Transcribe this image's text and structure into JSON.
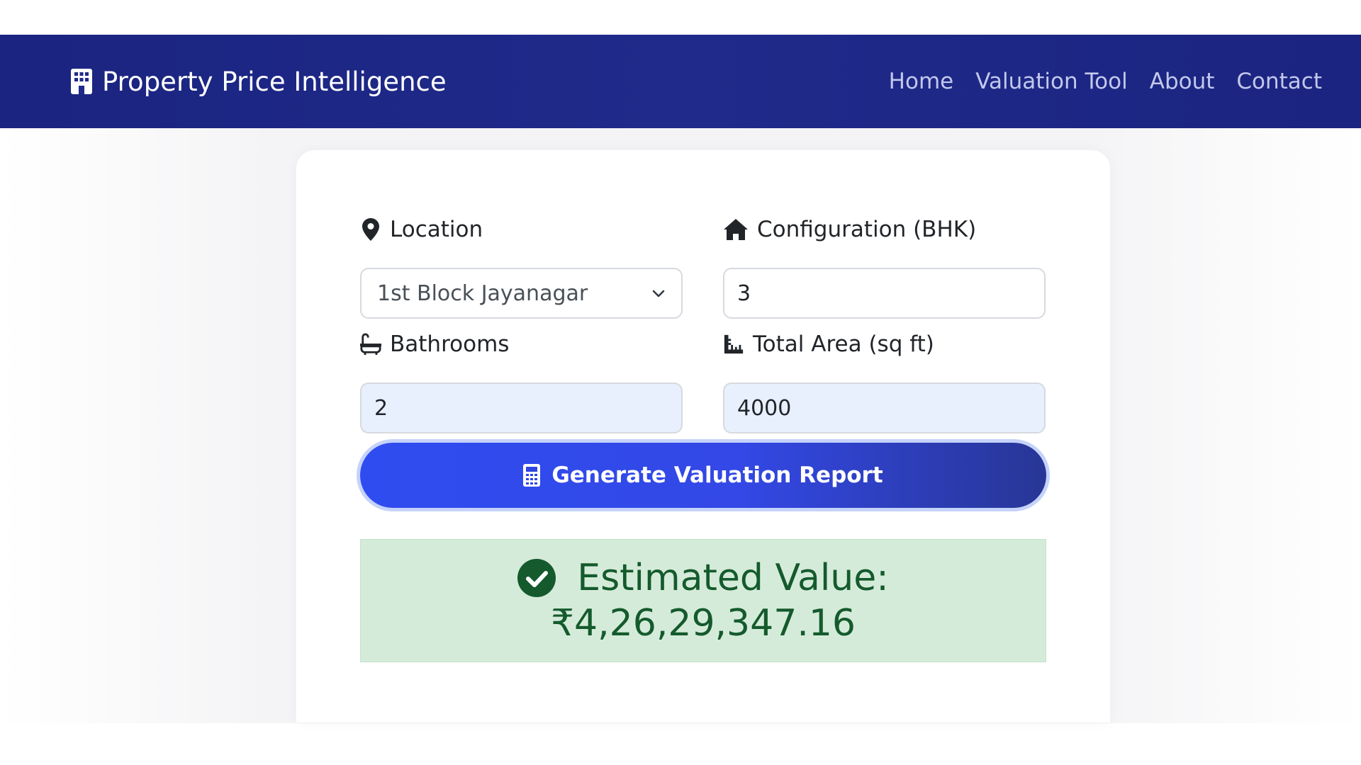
{
  "navbar": {
    "brand": "Property Price Intelligence",
    "links": [
      "Home",
      "Valuation Tool",
      "About",
      "Contact"
    ]
  },
  "form": {
    "location": {
      "label": "Location",
      "value": "1st Block Jayanagar",
      "icon": "map-pin-icon"
    },
    "bhk": {
      "label": "Configuration (BHK)",
      "value": "3",
      "icon": "home-icon"
    },
    "bathrooms": {
      "label": "Bathrooms",
      "value": "2",
      "icon": "bath-icon"
    },
    "area": {
      "label": "Total Area (sq ft)",
      "value": "4000",
      "icon": "ruler-icon"
    }
  },
  "button": {
    "label": "Generate Valuation Report",
    "icon": "calculator-icon"
  },
  "result": {
    "label": "Estimated Value:",
    "value": "₹4,26,29,347.16",
    "icon": "check-circle-icon"
  },
  "colors": {
    "navbar": "#1f2a8a",
    "button_start": "#2f4cf0",
    "button_end": "#283696",
    "result_bg": "#d5ebd9",
    "result_text": "#145a2d",
    "autofill_bg": "#e8f0fe"
  }
}
